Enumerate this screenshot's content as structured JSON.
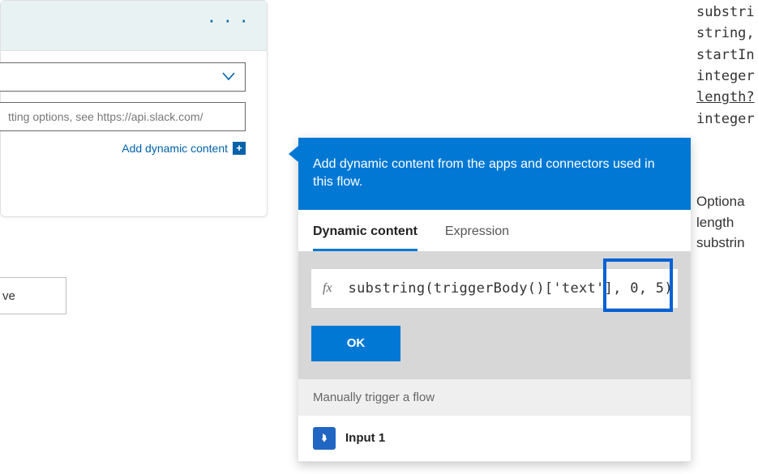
{
  "card": {
    "dropdown_value": "",
    "textbox_placeholder": "tting options, see https://api.slack.com/",
    "add_dynamic_label": "Add dynamic content"
  },
  "save_label": "ve",
  "flyout": {
    "banner_text": "Add dynamic content from the apps and connectors used in this flow.",
    "tabs": {
      "dynamic": "Dynamic content",
      "expression": "Expression"
    },
    "expression": {
      "fx_label": "fx",
      "formula": "substring(triggerBody()['text'], 0, 5)"
    },
    "ok_label": "OK",
    "group_header": "Manually trigger a flow",
    "items": [
      {
        "label": "Input 1"
      }
    ]
  },
  "tooltip": {
    "l1": "substri",
    "l2": "string,",
    "l3": "startIn",
    "l4": "integer",
    "l5": "length?",
    "l6": "integer",
    "d1": "Optiona",
    "d2": "length",
    "d3": "substrin"
  }
}
